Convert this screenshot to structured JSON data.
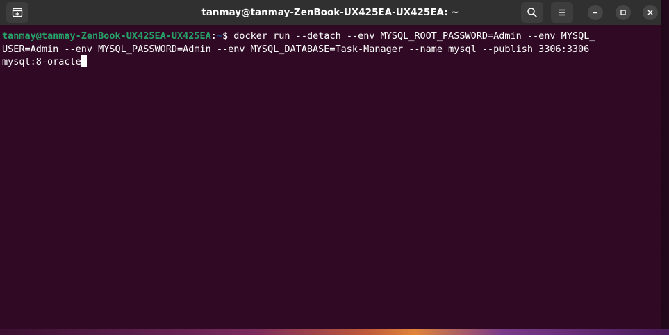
{
  "window": {
    "title": "tanmay@tanmay-ZenBook-UX425EA-UX425EA: ~"
  },
  "titlebar": {
    "new_tab_icon": "new-tab-icon",
    "search_icon": "search-icon",
    "menu_icon": "hamburger-menu-icon",
    "minimize_icon": "minimize-icon",
    "maximize_icon": "maximize-icon",
    "close_icon": "close-icon"
  },
  "terminal": {
    "prompt_user_host": "tanmay@tanmay-ZenBook-UX425EA-UX425EA",
    "prompt_colon": ":",
    "prompt_path": "~",
    "prompt_symbol": "$ ",
    "command_line_1": "docker run --detach --env MYSQL_ROOT_PASSWORD=Admin --env MYSQL_",
    "command_line_2": "USER=Admin --env MYSQL_PASSWORD=Admin --env MYSQL_DATABASE=Task-Manager --name mysql --publish 3306:3306",
    "command_line_3": "mysql:8-oracle"
  },
  "colors": {
    "terminal_background": "#300a24",
    "titlebar_background": "#303030",
    "prompt_user_color": "#26a269",
    "prompt_path_color": "#12488b",
    "text_color": "#ffffff"
  }
}
